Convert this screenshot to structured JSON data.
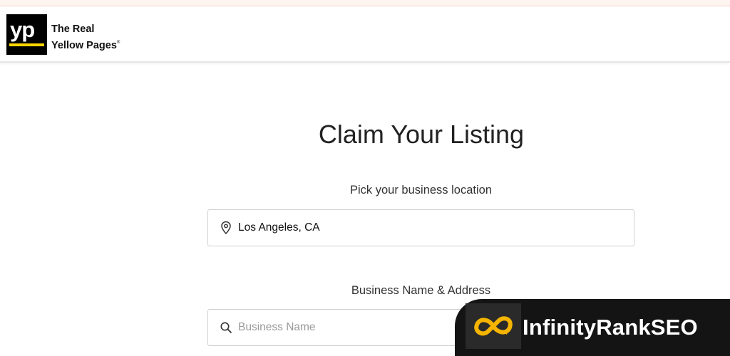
{
  "header": {
    "logo_mark": "yp",
    "logo_line1": "The Real",
    "logo_line2": "Yellow Pages",
    "logo_registered": "®"
  },
  "main": {
    "title": "Claim Your Listing",
    "location_label": "Pick your business location",
    "location_value": "Los Angeles, CA",
    "business_label": "Business Name & Address",
    "business_placeholder": "Business Name"
  },
  "watermark": {
    "text": "InfinityRankSEO",
    "icon": "infinity-icon"
  },
  "colors": {
    "logo_bg": "#000000",
    "logo_accent": "#ffd500",
    "watermark_bg": "#141414",
    "watermark_icon": "#f5b400"
  }
}
